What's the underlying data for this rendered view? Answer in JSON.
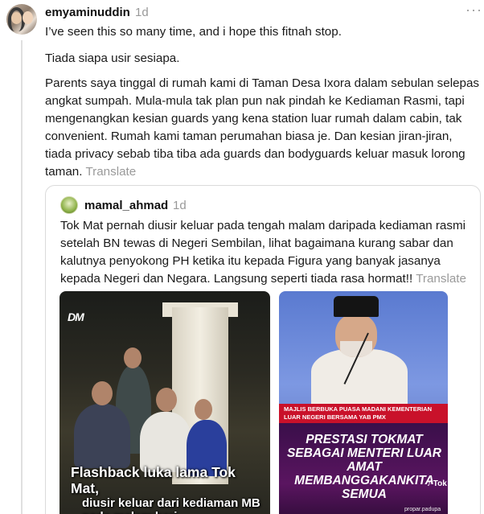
{
  "post": {
    "username": "emyaminuddin",
    "time": "1d",
    "more_icon": "more-horizontal-icon",
    "paragraphs": [
      "I’ve seen this so many time, and i hope this fitnah stop.",
      "Tiada siapa usir sesiapa.",
      "Parents saya tinggal di rumah kami di Taman Desa Ixora dalam sebulan selepas angkat sumpah. Mula-mula tak plan pun nak pindah ke Kediaman Rasmi, tapi mengenangkan kesian guards yang kena station luar rumah dalam cabin, tak convenient. Rumah kami taman perumahan biasa je. Dan kesian jiran-jiran, tiada privacy sebab tiba tiba ada guards dan bodyguards keluar masuk lorong taman."
    ],
    "translate_label": "Translate"
  },
  "quoted_post": {
    "username": "mamal_ahmad",
    "time": "1d",
    "text": "Tok Mat pernah diusir keluar pada tengah malam daripada kediaman rasmi setelah BN tewas di Negeri Sembilan, lihat bagaimana kurang sabar dan kalutnya penyokong PH ketika itu kepada Figura yang banyak jasanya kepada Negeri dan Negara. Langsung seperti tiada rasa hormat!!",
    "translate_label": "Translate",
    "image1": {
      "logo": "DM",
      "caption_line1": "Flashback luka lama Tok Mat,",
      "caption_line2": "diusir keluar dari kediaman MB pada malam hari"
    },
    "image2": {
      "banner_top": "MAJLIS BERBUKA PUASA MADANI KEMENTERIAN LUAR NEGERI BERSAMA YAB PMX",
      "banner_title": "PRESTASI TOKMAT SEBAGAI MENTERI LUAR AMAT MEMBANGGAKANKITA SEMUA",
      "tiktok_label": "Tok",
      "watermark": "propar.padupa"
    }
  }
}
